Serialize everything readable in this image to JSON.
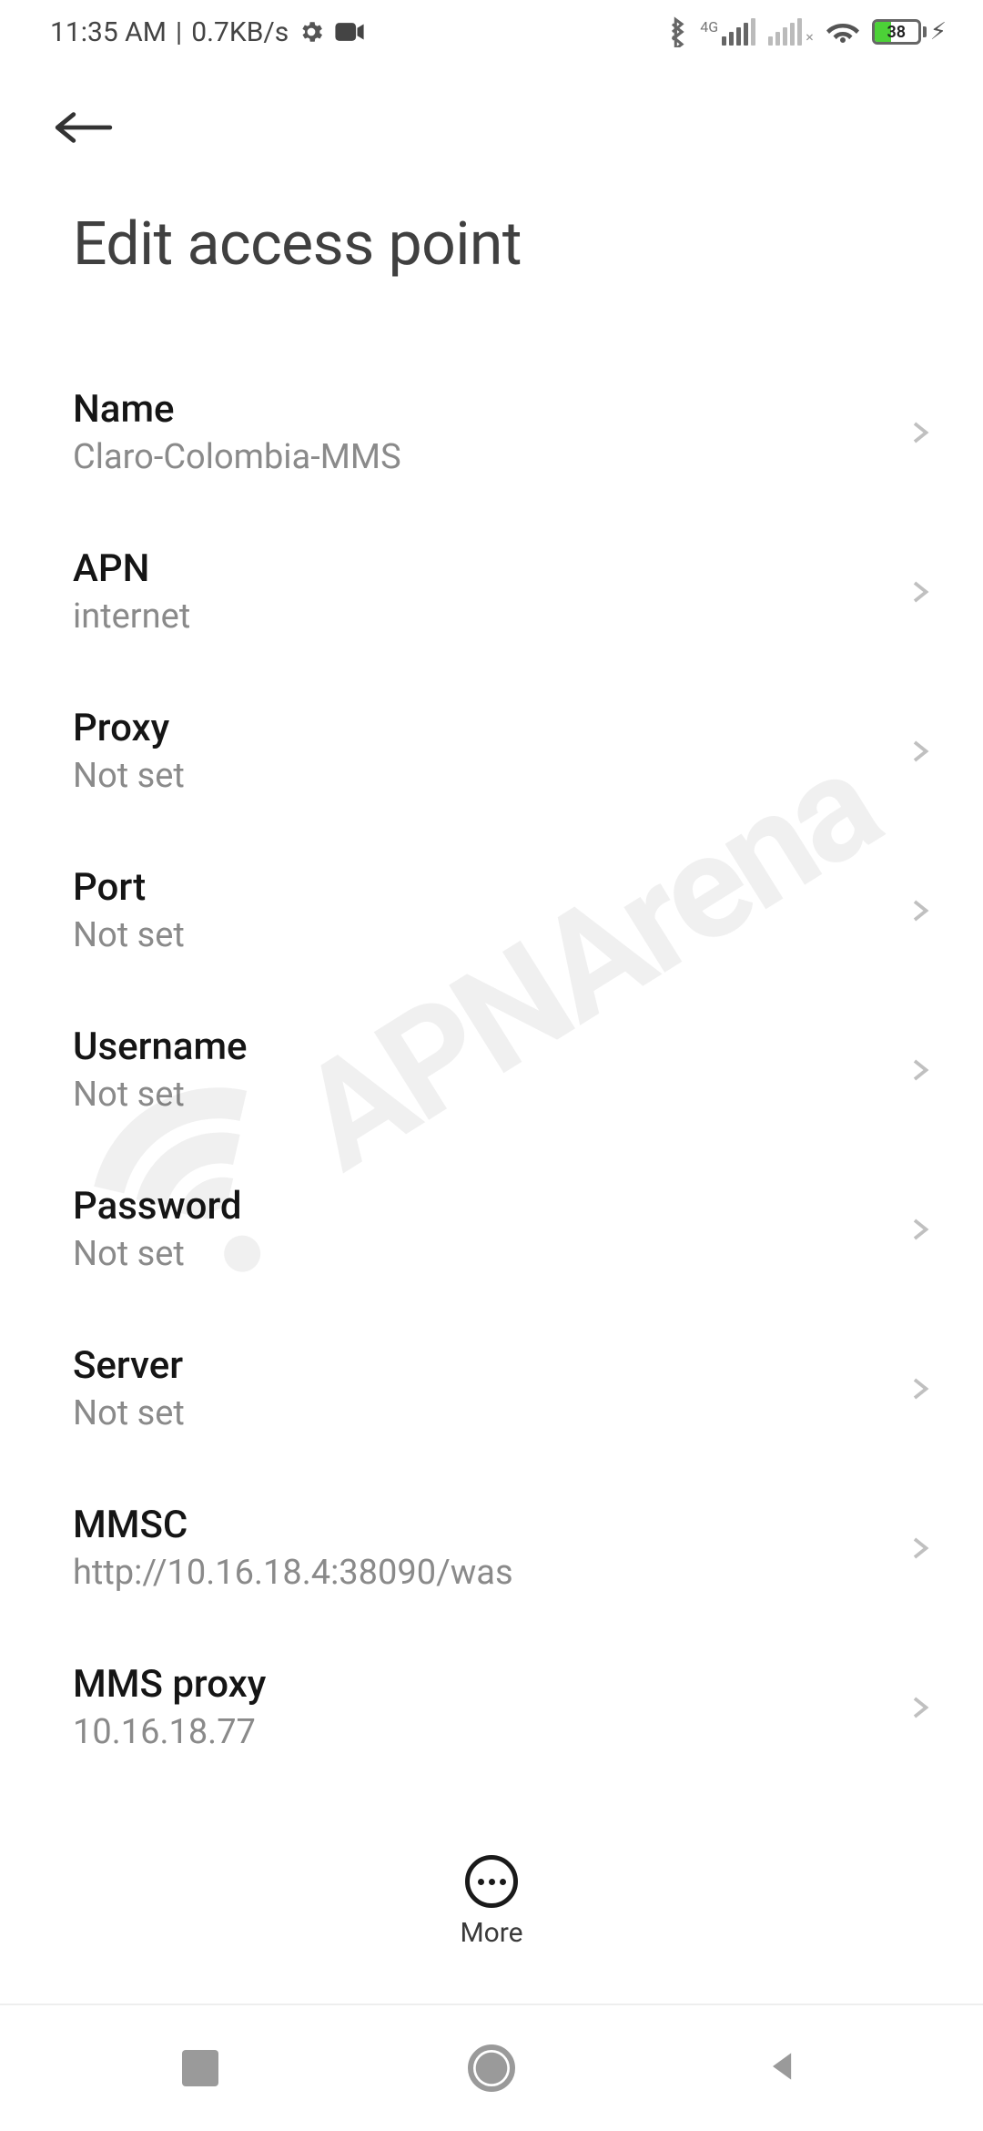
{
  "statusbar": {
    "time": "11:35 AM",
    "netspeed": "0.7KB/s",
    "signal_label": "4G",
    "battery_pct": "38"
  },
  "header": {
    "title": "Edit access point"
  },
  "rows": [
    {
      "label": "Name",
      "value": "Claro-Colombia-MMS"
    },
    {
      "label": "APN",
      "value": "internet"
    },
    {
      "label": "Proxy",
      "value": "Not set"
    },
    {
      "label": "Port",
      "value": "Not set"
    },
    {
      "label": "Username",
      "value": "Not set"
    },
    {
      "label": "Password",
      "value": "Not set"
    },
    {
      "label": "Server",
      "value": "Not set"
    },
    {
      "label": "MMSC",
      "value": "http://10.16.18.4:38090/was"
    },
    {
      "label": "MMS proxy",
      "value": "10.16.18.77"
    }
  ],
  "bottom": {
    "more_label": "More"
  },
  "watermark": {
    "text": "APNArena"
  }
}
